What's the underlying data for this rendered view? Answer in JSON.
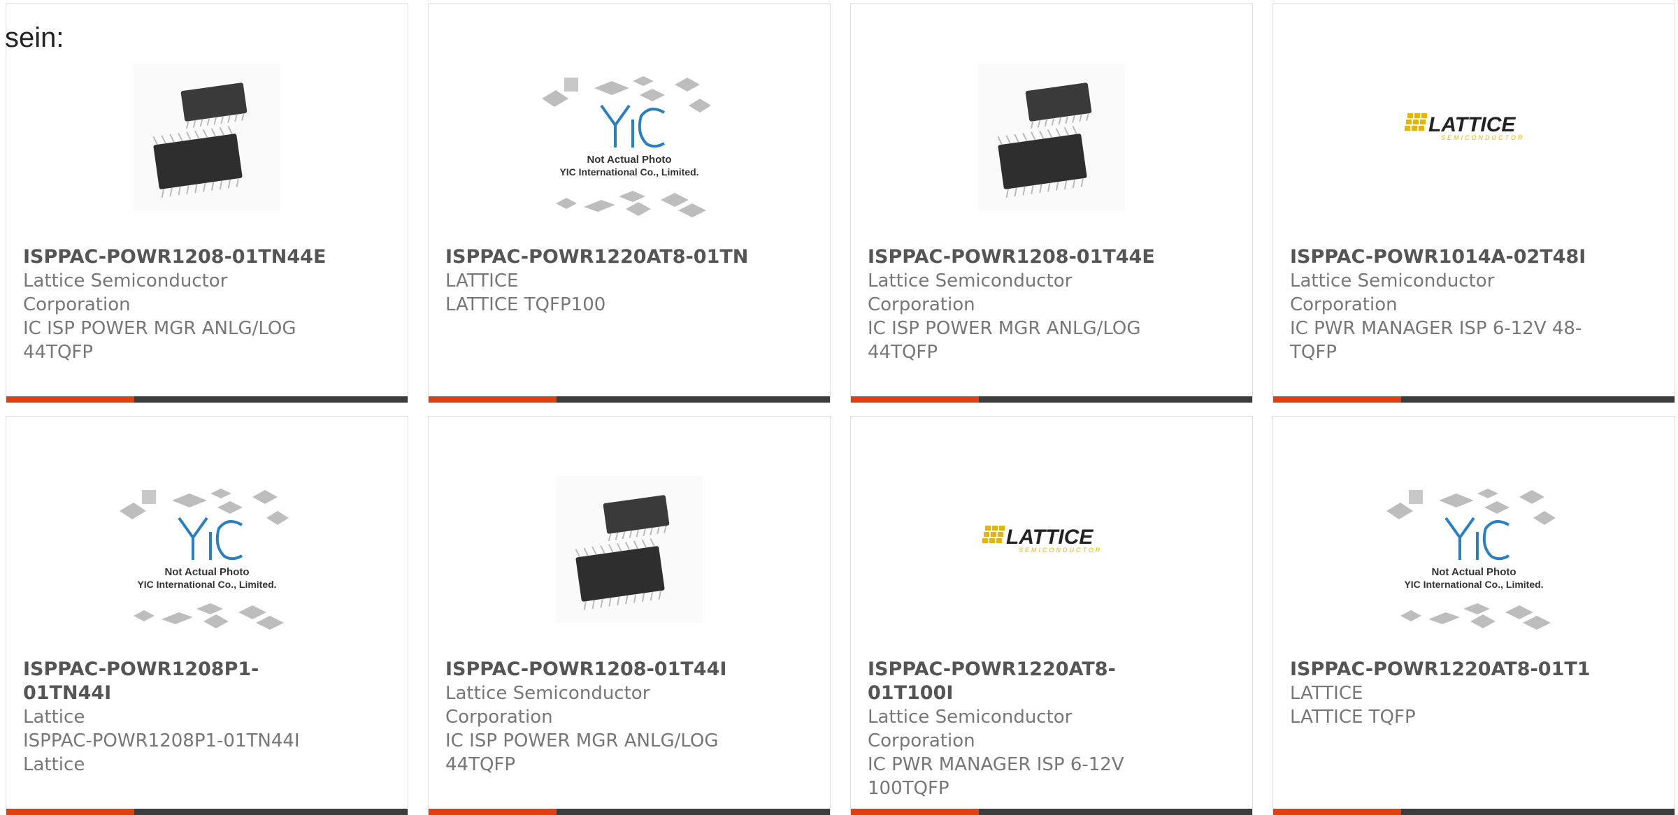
{
  "page": {
    "heading_fragment": "sein:"
  },
  "colors": {
    "accent_bar": "#e04010",
    "dark_bar": "#3c3c3c",
    "lattice_gold": "#e8b400",
    "yic_blue": "#2a7fc1"
  },
  "cards": [
    {
      "part_number": "ISPPAC-POWR1208-01TN44E",
      "lines": [
        "Lattice Semiconductor",
        "Corporation",
        "IC ISP POWER MGR ANLG/LOG",
        "44TQFP"
      ],
      "image": "chip-photo"
    },
    {
      "part_number": "ISPPAC-POWR1220AT8-01TN",
      "lines": [
        "LATTICE",
        "LATTICE TQFP100"
      ],
      "image": "yic-placeholder"
    },
    {
      "part_number": "ISPPAC-POWR1208-01T44E",
      "lines": [
        "Lattice Semiconductor",
        "Corporation",
        "IC ISP POWER MGR ANLG/LOG",
        "44TQFP"
      ],
      "image": "chip-photo"
    },
    {
      "part_number": "ISPPAC-POWR1014A-02T48I",
      "lines": [
        "Lattice Semiconductor",
        "Corporation",
        "IC PWR MANAGER ISP 6-12V 48-",
        "TQFP"
      ],
      "image": "lattice-logo"
    },
    {
      "part_number": "ISPPAC-POWR1208P1-01TN44I",
      "lines": [
        "Lattice",
        "ISPPAC-POWR1208P1-01TN44I",
        "Lattice"
      ],
      "image": "yic-placeholder"
    },
    {
      "part_number": "ISPPAC-POWR1208-01T44I",
      "lines": [
        "Lattice Semiconductor",
        "Corporation",
        "IC ISP POWER MGR ANLG/LOG",
        "44TQFP"
      ],
      "image": "chip-photo"
    },
    {
      "part_number": "ISPPAC-POWR1220AT8-01T100I",
      "lines": [
        "Lattice Semiconductor",
        "Corporation",
        "IC PWR MANAGER ISP 6-12V",
        "100TQFP"
      ],
      "image": "lattice-logo"
    },
    {
      "part_number": "ISPPAC-POWR1220AT8-01T1",
      "lines": [
        "LATTICE",
        "LATTICE TQFP"
      ],
      "image": "yic-placeholder"
    }
  ],
  "placeholder_text": {
    "line1": "Not Actual Photo",
    "line2": "YIC International Co., Limited."
  },
  "logo_text": {
    "brand": "LATTICE",
    "tagline": "SEMICONDUCTOR"
  }
}
